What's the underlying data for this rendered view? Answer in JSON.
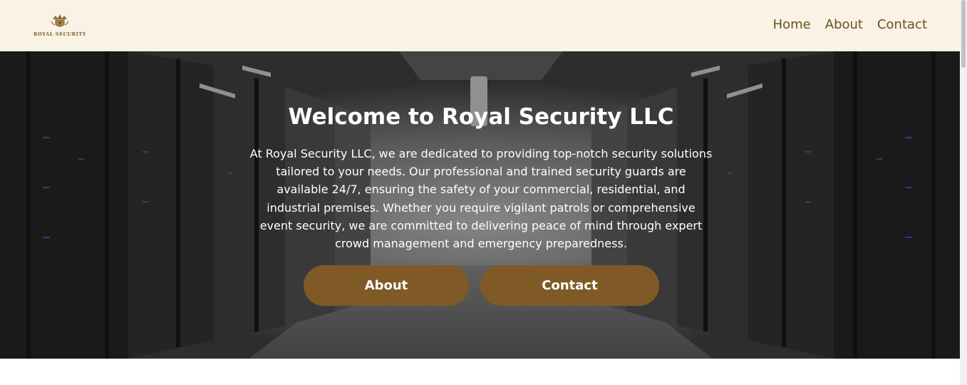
{
  "brand": {
    "logo_text": "ROYAL SECURITY",
    "colors": {
      "header_bg": "#faf2e4",
      "accent": "#7f5a27",
      "nav_text": "#6b5024"
    }
  },
  "nav": {
    "items": [
      "Home",
      "About",
      "Contact"
    ]
  },
  "hero": {
    "title": "Welcome to Royal Security LLC",
    "description": "At Royal Security LLC, we are dedicated to providing top-notch security solutions tailored to your needs. Our professional and trained security guards are available 24/7, ensuring the safety of your commercial, residential, and industrial premises. Whether you require vigilant patrols or comprehensive event security, we are committed to delivering peace of mind through expert crowd management and emergency preparedness.",
    "buttons": {
      "about": "About",
      "contact": "Contact"
    }
  }
}
